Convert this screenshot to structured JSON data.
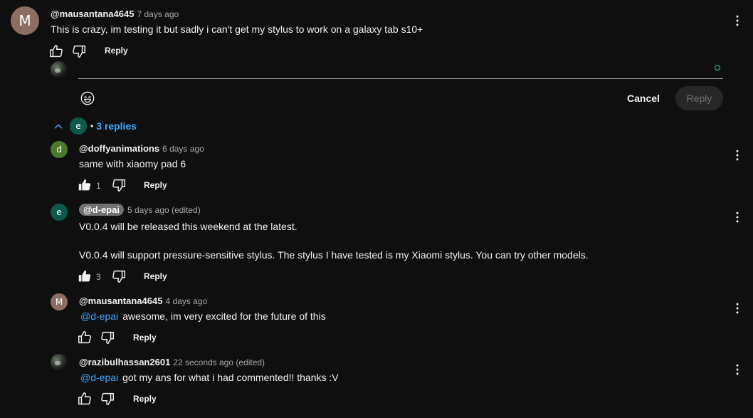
{
  "top_comment": {
    "avatar_letter": "M",
    "handle": "@mausantana4645",
    "time": "7 days ago",
    "text": "This is crazy, im testing it but sadly i can't get my stylus to work on a galaxy tab s10+",
    "reply_label": "Reply"
  },
  "reply_box": {
    "cancel_label": "Cancel",
    "submit_label": "Reply"
  },
  "replies_toggle": {
    "avatar_letter": "e",
    "bullet": "•",
    "label": "3 replies"
  },
  "replies": [
    {
      "avatar_letter": "d",
      "handle": "@doffyanimations",
      "time": "6 days ago",
      "text": "same with xiaomy pad 6",
      "likes": "1",
      "reply_label": "Reply"
    },
    {
      "avatar_letter": "e",
      "handle": "@d-epai",
      "time": "5 days ago (edited)",
      "text_line1": "V0.0.4 will be released this weekend at the latest.",
      "text_line2": "V0.0.4 will support pressure-sensitive stylus. The stylus I have tested is my Xiaomi stylus. You can try other models.",
      "likes": "3",
      "reply_label": "Reply"
    },
    {
      "avatar_letter": "M",
      "handle": "@mausantana4645",
      "time": "4 days ago",
      "mention": "@d-epai",
      "text": "awesome, im very excited for the future of this",
      "reply_label": "Reply"
    },
    {
      "handle": "@razibulhassan2601",
      "time": "22 seconds ago (edited)",
      "mention": "@d-epai",
      "text": "got my ans for what i had commented!! thanks :V",
      "reply_label": "Reply"
    }
  ],
  "colors": {
    "background": "#0f0f0f",
    "link": "#3ea6ff",
    "avatar_m": "#8d6e63",
    "avatar_d": "#4b7a2a",
    "avatar_e": "#0b5a4c",
    "input_dot": "#2ec4a6"
  },
  "icons": [
    "thumbs-up-icon",
    "thumbs-down-icon",
    "kebab-menu-icon",
    "emoji-icon",
    "chevron-up-icon"
  ]
}
